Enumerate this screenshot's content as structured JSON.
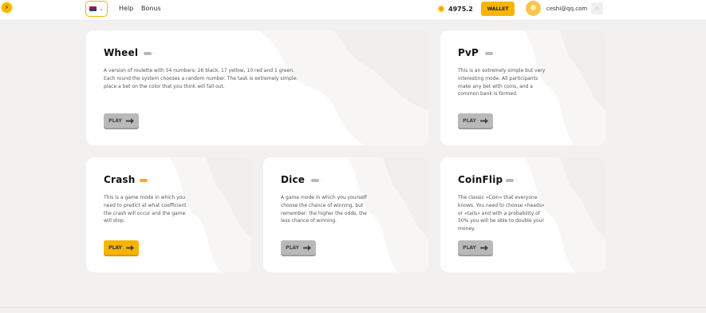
{
  "header": {
    "logo_icon": "app-logo-icon",
    "language_icon": "uk-flag-icon",
    "nav": [
      {
        "label": "Help"
      },
      {
        "label": "Bonus"
      }
    ],
    "balance": "4975.2",
    "wallet_label": "WALLET",
    "user_email": "ceshi@qq.com"
  },
  "games": [
    {
      "title": "Wheel",
      "description": "A version of roulette with 54 numbers: 26 black, 17 yellow, 10 red and 1 green. Each round the system chooses a random number. The task is extremely simple: place a bet on the color that you think will fall out.",
      "play_label": "PLAY",
      "active": false
    },
    {
      "title": "PvP",
      "description": "This is an extremely simple but very interesting mode. All participants make any bet with coins, and a common bank is formed.",
      "play_label": "PLAY",
      "active": false
    },
    {
      "title": "Crash",
      "description": "This is a game mode in which you need to predict at what coefficient the crash will occur and the game will stop.",
      "play_label": "PLAY",
      "active": true
    },
    {
      "title": "Dice",
      "description": "A game mode in which you yourself choose the chance of winning, but remember: the higher the odds, the less chance of winning.",
      "play_label": "PLAY",
      "active": false
    },
    {
      "title": "CoinFlip",
      "description": "The classic «Coin» that everyone knows. You need to choose «heads» or «tails» and with a probability of 50% you will be able to double your money.",
      "play_label": "PLAY",
      "active": false
    }
  ],
  "colors": {
    "accent": "#f6b400",
    "background": "#f3f1ef",
    "card": "#ffffff",
    "inactive_button": "#b9b9b9"
  }
}
